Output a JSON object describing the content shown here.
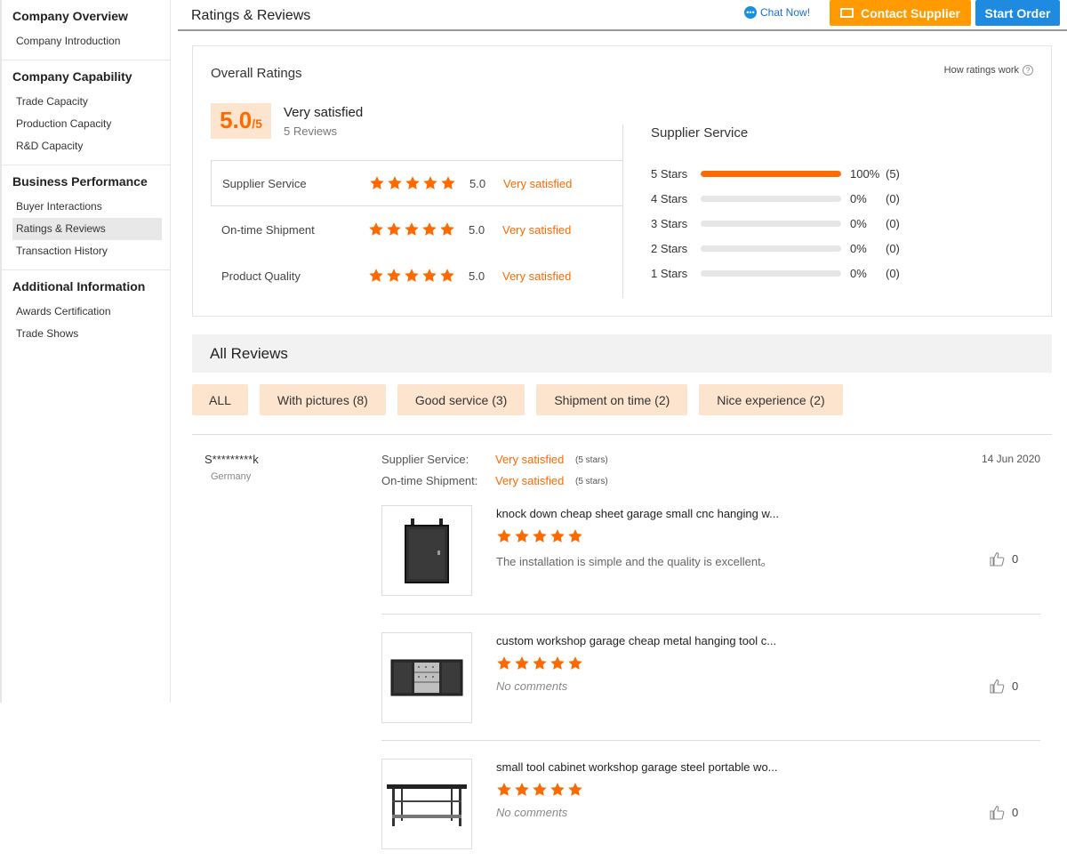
{
  "sidebar": {
    "groups": [
      {
        "title": "Company Overview",
        "items": [
          "Company Introduction"
        ]
      },
      {
        "title": "Company Capability",
        "items": [
          "Trade Capacity",
          "Production Capacity",
          "R&D Capacity"
        ]
      },
      {
        "title": "Business Performance",
        "items": [
          "Buyer Interactions",
          "Ratings & Reviews",
          "Transaction History"
        ]
      },
      {
        "title": "Additional Information",
        "items": [
          "Awards Certification",
          "Trade Shows"
        ]
      }
    ],
    "active": "Ratings & Reviews"
  },
  "header": {
    "title": "Ratings & Reviews",
    "chat_now": "Chat Now!",
    "contact_supplier": "Contact Supplier",
    "start_order": "Start Order"
  },
  "overall": {
    "title": "Overall Ratings",
    "how_ratings": "How ratings work",
    "score": "5.0",
    "score_max": "/5",
    "satisfaction": "Very satisfied",
    "review_count": "5 Reviews",
    "categories": [
      {
        "label": "Supplier Service",
        "stars": 5,
        "score": "5.0",
        "satisfaction": "Very satisfied"
      },
      {
        "label": "On-time Shipment",
        "stars": 5,
        "score": "5.0",
        "satisfaction": "Very satisfied"
      },
      {
        "label": "Product Quality",
        "stars": 5,
        "score": "5.0",
        "satisfaction": "Very satisfied"
      }
    ],
    "distribution_title": "Supplier Service",
    "distribution": [
      {
        "label": "5  Stars",
        "percent": 100,
        "pct_text": "100%",
        "count": "(5)"
      },
      {
        "label": "4  Stars",
        "percent": 0,
        "pct_text": "0%",
        "count": "(0)"
      },
      {
        "label": "3  Stars",
        "percent": 0,
        "pct_text": "0%",
        "count": "(0)"
      },
      {
        "label": "2  Stars",
        "percent": 0,
        "pct_text": "0%",
        "count": "(0)"
      },
      {
        "label": "1  Stars",
        "percent": 0,
        "pct_text": "0%",
        "count": "(0)"
      }
    ]
  },
  "all_reviews": {
    "title": "All Reviews",
    "filters": [
      "ALL",
      "With pictures (8)",
      "Good service (3)",
      "Shipment on time (2)",
      "Nice experience (2)"
    ]
  },
  "review": {
    "reviewer": "S*********k",
    "country": "Germany",
    "date": "14 Jun 2020",
    "ratings": [
      {
        "label": "Supplier Service:",
        "value": "Very satisfied",
        "stars": "(5 stars)"
      },
      {
        "label": "On-time Shipment:",
        "value": "Very satisfied",
        "stars": "(5 stars)"
      }
    ],
    "products": [
      {
        "name": "knock down cheap sheet garage small cnc hanging w...",
        "stars": 5,
        "comment": "The installation is simple and the quality is excellent。",
        "likes": "0",
        "image": "wall-cabinet-image"
      },
      {
        "name": "custom workshop garage cheap metal hanging tool c...",
        "stars": 5,
        "comment": "No comments",
        "likes": "0",
        "image": "hanging-tool-cabinet-image"
      },
      {
        "name": "small tool cabinet workshop garage steel portable wo...",
        "stars": 5,
        "comment": "No comments",
        "likes": "0",
        "image": "workbench-image"
      }
    ]
  },
  "colors": {
    "accent_orange": "#ff6a00",
    "contact_button": "#ff9a00",
    "order_button": "#1f8be0",
    "filter_bg": "#fde4cf"
  }
}
